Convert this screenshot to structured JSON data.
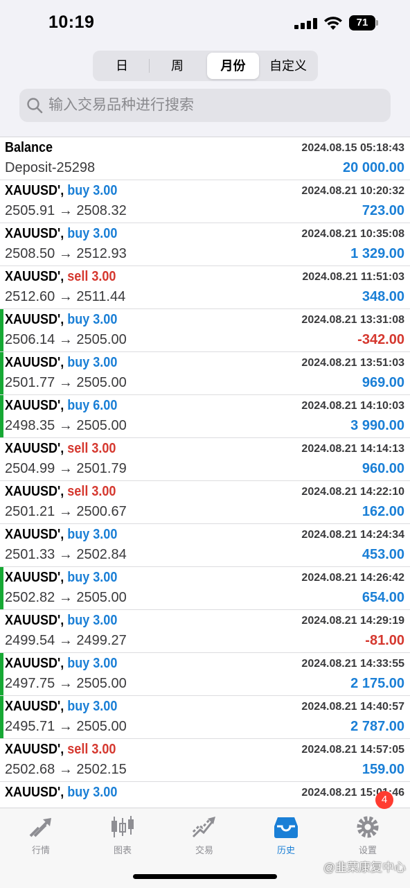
{
  "status": {
    "time": "10:19",
    "battery": "71"
  },
  "segments": [
    {
      "label": "日",
      "active": false
    },
    {
      "label": "周",
      "active": false
    },
    {
      "label": "月份",
      "active": true
    },
    {
      "label": "自定义",
      "active": false
    }
  ],
  "search": {
    "placeholder": "输入交易品种进行搜索"
  },
  "rows": [
    {
      "title": "Balance",
      "direction": "",
      "type": "",
      "sub": "Deposit-25298",
      "time": "2024.08.15 05:18:43",
      "value": "20 000.00",
      "negative": false,
      "flag": false
    },
    {
      "title": "XAUUSD',",
      "direction": "buy 3.00",
      "type": "buy",
      "sub": "2505.91 → 2508.32",
      "time": "2024.08.21 10:20:32",
      "value": "723.00",
      "negative": false,
      "flag": false
    },
    {
      "title": "XAUUSD',",
      "direction": "buy 3.00",
      "type": "buy",
      "sub": "2508.50 → 2512.93",
      "time": "2024.08.21 10:35:08",
      "value": "1 329.00",
      "negative": false,
      "flag": false
    },
    {
      "title": "XAUUSD',",
      "direction": "sell 3.00",
      "type": "sell",
      "sub": "2512.60 → 2511.44",
      "time": "2024.08.21 11:51:03",
      "value": "348.00",
      "negative": false,
      "flag": false
    },
    {
      "title": "XAUUSD',",
      "direction": "buy 3.00",
      "type": "buy",
      "sub": "2506.14 → 2505.00",
      "time": "2024.08.21 13:31:08",
      "value": "-342.00",
      "negative": true,
      "flag": true
    },
    {
      "title": "XAUUSD',",
      "direction": "buy 3.00",
      "type": "buy",
      "sub": "2501.77 → 2505.00",
      "time": "2024.08.21 13:51:03",
      "value": "969.00",
      "negative": false,
      "flag": true
    },
    {
      "title": "XAUUSD',",
      "direction": "buy 6.00",
      "type": "buy",
      "sub": "2498.35 → 2505.00",
      "time": "2024.08.21 14:10:03",
      "value": "3 990.00",
      "negative": false,
      "flag": true
    },
    {
      "title": "XAUUSD',",
      "direction": "sell 3.00",
      "type": "sell",
      "sub": "2504.99 → 2501.79",
      "time": "2024.08.21 14:14:13",
      "value": "960.00",
      "negative": false,
      "flag": false
    },
    {
      "title": "XAUUSD',",
      "direction": "sell 3.00",
      "type": "sell",
      "sub": "2501.21 → 2500.67",
      "time": "2024.08.21 14:22:10",
      "value": "162.00",
      "negative": false,
      "flag": false
    },
    {
      "title": "XAUUSD',",
      "direction": "buy 3.00",
      "type": "buy",
      "sub": "2501.33 → 2502.84",
      "time": "2024.08.21 14:24:34",
      "value": "453.00",
      "negative": false,
      "flag": false
    },
    {
      "title": "XAUUSD',",
      "direction": "buy 3.00",
      "type": "buy",
      "sub": "2502.82 → 2505.00",
      "time": "2024.08.21 14:26:42",
      "value": "654.00",
      "negative": false,
      "flag": true
    },
    {
      "title": "XAUUSD',",
      "direction": "buy 3.00",
      "type": "buy",
      "sub": "2499.54 → 2499.27",
      "time": "2024.08.21 14:29:19",
      "value": "-81.00",
      "negative": true,
      "flag": false
    },
    {
      "title": "XAUUSD',",
      "direction": "buy 3.00",
      "type": "buy",
      "sub": "2497.75 → 2505.00",
      "time": "2024.08.21 14:33:55",
      "value": "2 175.00",
      "negative": false,
      "flag": true
    },
    {
      "title": "XAUUSD',",
      "direction": "buy 3.00",
      "type": "buy",
      "sub": "2495.71 → 2505.00",
      "time": "2024.08.21 14:40:57",
      "value": "2 787.00",
      "negative": false,
      "flag": true
    },
    {
      "title": "XAUUSD',",
      "direction": "sell 3.00",
      "type": "sell",
      "sub": "2502.68 → 2502.15",
      "time": "2024.08.21 14:57:05",
      "value": "159.00",
      "negative": false,
      "flag": false
    },
    {
      "title": "XAUUSD',",
      "direction": "buy 3.00",
      "type": "buy",
      "sub": "",
      "time": "2024.08.21 15:01:46",
      "value": "",
      "negative": false,
      "flag": false
    }
  ],
  "tabs": [
    {
      "label": "行情",
      "icon": "quotes-icon",
      "active": false
    },
    {
      "label": "图表",
      "icon": "chart-icon",
      "active": false
    },
    {
      "label": "交易",
      "icon": "trade-icon",
      "active": false
    },
    {
      "label": "历史",
      "icon": "history-icon",
      "active": true
    },
    {
      "label": "设置",
      "icon": "settings-icon",
      "active": false
    }
  ],
  "settings_badge": "4",
  "watermark": "@韭菜康复中心",
  "colors": {
    "buy": "#1a7fd6",
    "sell": "#d5382f",
    "flag": "#17a834",
    "accent": "#1a7fd6"
  }
}
